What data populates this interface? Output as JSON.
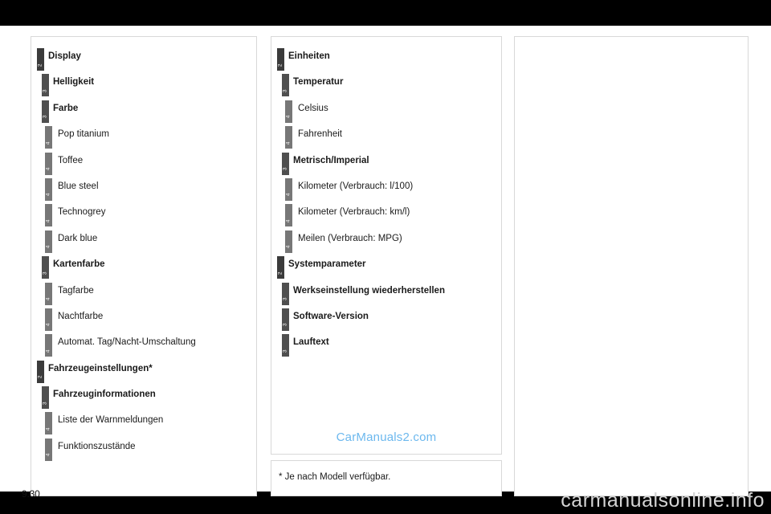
{
  "page": {
    "number": "9.30",
    "site_watermark": "carmanualsonline.info",
    "content_watermark": "CarManuals2.com",
    "footnote": "* Je nach Modell verfügbar.",
    "colors": {
      "background": "#000000",
      "sheet": "#ffffff",
      "border": "#d8d8d8",
      "level2_bar": "#3b3b3b",
      "level3_bar": "#4f4f4f",
      "level4_bar": "#777777",
      "text": "#1a1a1a",
      "watermark_blue": "#6cb8ee",
      "watermark_gray": "#d4d4d4"
    }
  },
  "columns": {
    "left": {
      "items": [
        {
          "level": "2",
          "label": "Display"
        },
        {
          "level": "3",
          "label": "Helligkeit"
        },
        {
          "level": "3",
          "label": "Farbe"
        },
        {
          "level": "4",
          "label": "Pop titanium"
        },
        {
          "level": "4",
          "label": "Toffee"
        },
        {
          "level": "4",
          "label": "Blue steel"
        },
        {
          "level": "4",
          "label": "Technogrey"
        },
        {
          "level": "4",
          "label": "Dark blue"
        },
        {
          "level": "3",
          "label": "Kartenfarbe"
        },
        {
          "level": "4",
          "label": "Tagfarbe"
        },
        {
          "level": "4",
          "label": "Nachtfarbe"
        },
        {
          "level": "4",
          "label": "Automat. Tag/Nacht-Umschaltung"
        },
        {
          "level": "2",
          "label": "Fahrzeugeinstellungen*"
        },
        {
          "level": "3",
          "label": "Fahrzeuginformationen"
        },
        {
          "level": "4",
          "label": "Liste der Warnmeldungen"
        },
        {
          "level": "4",
          "label": "Funktionszustände"
        }
      ]
    },
    "middle": {
      "items": [
        {
          "level": "2",
          "label": "Einheiten"
        },
        {
          "level": "3",
          "label": "Temperatur"
        },
        {
          "level": "4",
          "label": "Celsius"
        },
        {
          "level": "4",
          "label": "Fahrenheit"
        },
        {
          "level": "3",
          "label": "Metrisch/Imperial"
        },
        {
          "level": "4",
          "label": "Kilometer (Verbrauch: l/100)"
        },
        {
          "level": "4",
          "label": "Kilometer (Verbrauch: km/l)"
        },
        {
          "level": "4",
          "label": "Meilen (Verbrauch: MPG)"
        },
        {
          "level": "2",
          "label": "Systemparameter"
        },
        {
          "level": "3",
          "label": "Werkseinstellung wiederherstellen"
        },
        {
          "level": "3",
          "label": "Software-Version"
        },
        {
          "level": "3",
          "label": "Lauftext"
        }
      ]
    },
    "right": {
      "items": []
    }
  }
}
